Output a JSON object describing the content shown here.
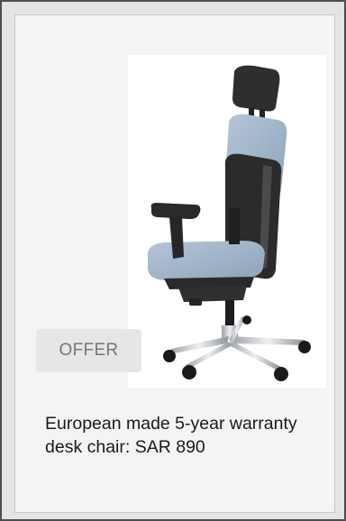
{
  "product": {
    "badge_label": "OFFER",
    "description": "European made 5-year warranty desk chair: SAR 890",
    "image_icon": "office-chair-image"
  },
  "colors": {
    "card_background": "#f4f4f4",
    "outer_background": "#e4e4e4",
    "frame_border": "#4d4d4d",
    "chair_fabric": "#9db2c8",
    "chair_frame": "#2a2a2a",
    "base_metal": "#c8cacc"
  }
}
